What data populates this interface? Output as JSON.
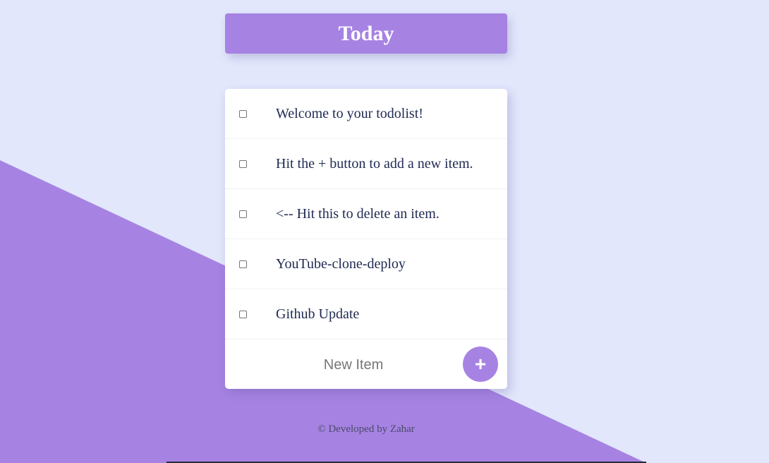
{
  "header": {
    "title": "Today"
  },
  "todo": {
    "items": [
      {
        "label": "Welcome to your todolist!",
        "checked": false
      },
      {
        "label": "Hit the + button to add a new item.",
        "checked": false
      },
      {
        "label": "<-- Hit this to delete an item.",
        "checked": false
      },
      {
        "label": "YouTube-clone-deploy",
        "checked": false
      },
      {
        "label": "Github Update",
        "checked": false
      }
    ],
    "new_item": {
      "placeholder": "New Item",
      "value": ""
    },
    "add_button_label": "+"
  },
  "footer": {
    "text": "© Developed by Zahar"
  },
  "colors": {
    "background": "#e2e7fc",
    "accent": "#a683e3",
    "text": "#1f2a52"
  }
}
